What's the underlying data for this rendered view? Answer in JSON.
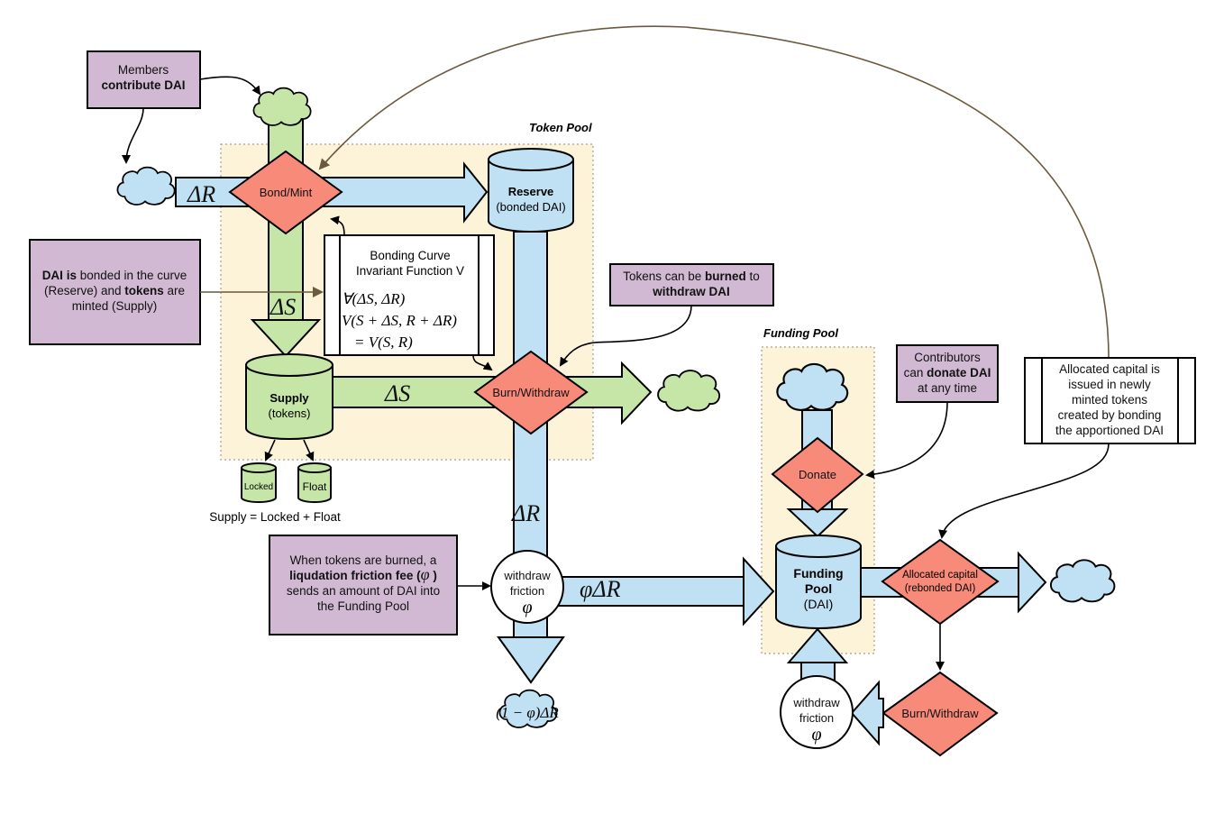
{
  "colors": {
    "reserve_flow": "#bfe1f3",
    "token_flow": "#c6e6a8",
    "decision": "#f88a7a",
    "note": "#d1b9d3",
    "pool_background": "#fdf3d8"
  },
  "pools": {
    "token_pool": "Token Pool",
    "funding_pool": "Funding Pool"
  },
  "notes": {
    "members": {
      "line1": "Members",
      "line2_bold": "contribute DAI"
    },
    "bonded": {
      "l1_bold": "DAI is",
      "l1": " bonded in the curve",
      "l2a": "(Reserve) and ",
      "l2_bold": "tokens",
      "l2b": " are",
      "l3": "minted (Supply)"
    },
    "burned": {
      "l1a": "Tokens can be ",
      "l1_bold": "burned",
      "l1b": " to",
      "l2_bold": "withdraw DAI"
    },
    "contributors": {
      "l1": "Contributors",
      "l2a": "can ",
      "l2_bold": "donate DAI",
      "l3": "at any time"
    },
    "friction": {
      "l1": "When tokens are burned, a",
      "l2_bold": "liqudation friction fee (",
      "l2_sym": "φ",
      "l2_end": " )",
      "l3": "sends an amount of DAI into",
      "l4": "the Funding Pool"
    }
  },
  "process_boxes": {
    "bonding_curve": {
      "title1": "Bonding Curve",
      "title2": "Invariant Function V",
      "eq1": "∀(ΔS, ΔR)",
      "eq2": "V(S + ΔS, R + ΔR)",
      "eq3": "= V(S, R)"
    },
    "allocated": {
      "lines": [
        "Allocated capital is",
        "issued in newly",
        "minted tokens",
        "created by bonding",
        "the apportioned DAI"
      ]
    }
  },
  "decisions": {
    "bond_mint": "Bond/Mint",
    "burn_withdraw": "Burn/Withdraw",
    "donate": "Donate",
    "allocated": {
      "line1": "Allocated capital",
      "line2": "(rebonded DAI)"
    },
    "burn_withdraw_2": "Burn/Withdraw"
  },
  "stores": {
    "reserve": {
      "title": "Reserve",
      "sub": "(bonded DAI)"
    },
    "supply": {
      "title": "Supply",
      "sub": "(tokens)"
    },
    "locked": "Locked",
    "float": "Float",
    "supply_eq": "Supply = Locked + Float",
    "funding_pool": {
      "title1": "Funding",
      "title2": "Pool",
      "sub": "(DAI)"
    }
  },
  "friction_nodes": {
    "main": {
      "l1": "withdraw",
      "l2": "friction",
      "sym": "φ"
    },
    "secondary": {
      "l1": "withdraw",
      "l2": "friction",
      "sym": "φ"
    }
  },
  "flow_labels": {
    "delta_r_in": "ΔR",
    "delta_s_down": "ΔS",
    "delta_s_burn": "ΔS",
    "delta_r_down": "ΔR",
    "phi_delta_r": "φΔR",
    "remainder": "(1 − φ)ΔR"
  }
}
